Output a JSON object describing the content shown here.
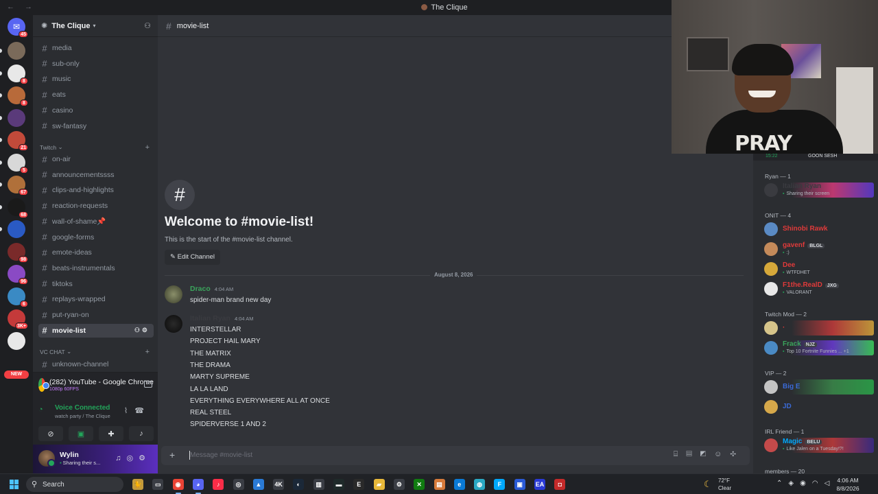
{
  "window": {
    "title": "The Clique",
    "nav": "← →"
  },
  "rail": {
    "home_badge": "45",
    "servers": [
      {
        "color": "#7a6a5a",
        "badge": ""
      },
      {
        "color": "#e8e8e8",
        "badge": "8"
      },
      {
        "color": "#b86a3a",
        "badge": "8"
      },
      {
        "color": "#5a3a7a",
        "badge": ""
      },
      {
        "color": "#c24a3a",
        "badge": "21"
      },
      {
        "color": "#d8d8d8",
        "badge": "5"
      },
      {
        "color": "#b0703a",
        "badge": "67"
      },
      {
        "color": "#1a1a1a",
        "badge": "68"
      },
      {
        "color": "#2a5ac4",
        "badge": ""
      },
      {
        "color": "#7a2a2a",
        "badge": "98"
      },
      {
        "color": "#8a4ac4",
        "badge": "96"
      },
      {
        "color": "#3a8ac4",
        "badge": "6"
      },
      {
        "color": "#c43a3a",
        "badge": "3K+"
      },
      {
        "color": "#e8e8e8",
        "badge": ""
      }
    ],
    "new_label": "NEW"
  },
  "server": {
    "name": "The Clique"
  },
  "channels_top": [
    "media",
    "sub-only",
    "music",
    "eats",
    "casino",
    "sw-fantasy"
  ],
  "categories": {
    "twitch": "Twitch",
    "vc": "VC CHAT"
  },
  "channels_twitch": [
    "on-air",
    "announcementssss",
    "clips-and-highlights",
    "reaction-requests",
    "wall-of-shame📌",
    "google-forms",
    "emote-ideas",
    "beats-instrumentals",
    "tiktoks",
    "replays-wrapped",
    "put-ryan-on",
    "movie-list"
  ],
  "channels_vc": [
    "unknown-channel"
  ],
  "stream": {
    "title": "(282) YouTube - Google Chrome",
    "quality": "1080p 60FPS"
  },
  "voice": {
    "title": "Voice Connected",
    "subtitle": "watch party / The Clique"
  },
  "user": {
    "name": "Wylin",
    "status": "Sharing their s..."
  },
  "chat": {
    "channel": "movie-list",
    "welcome_title": "Welcome to #movie-list!",
    "welcome_sub": "This is the start of the #movie-list channel.",
    "edit_label": "Edit Channel",
    "date": "August 8, 2026",
    "messages": [
      {
        "author": "Draco",
        "color": "#3ba55c",
        "time": "4:04 AM",
        "lines": [
          "spider-man brand new day"
        ]
      },
      {
        "author": "Italian Ryan",
        "color": "#3a3b40",
        "time": "4:04 AM",
        "lines": [
          "INTERSTELLAR",
          "PROJECT HAIL MARY",
          "THE MATRIX",
          "THE DRAMA",
          "MARTY SUPREME",
          "LA LA LAND",
          "EVERYTHING EVERYWHERE ALL AT ONCE",
          "REAL STEEL",
          "SPIDERVERSE 1 AND 2"
        ]
      }
    ],
    "placeholder": "Message #movie-list"
  },
  "cam_overlay": {
    "time": "15:22",
    "label": "GOON SESH",
    "shirt_text": "PRAY"
  },
  "members": {
    "groups": [
      {
        "title": "Ryan — 1",
        "members": [
          {
            "name": "Italian Ryan",
            "color": "#3a3b40",
            "status": "Sharing their screen",
            "tag": "",
            "bar": "linear-gradient(90deg, transparent, #d63a7a, #5a3ad6)"
          }
        ]
      },
      {
        "title": "ONIT — 4",
        "members": [
          {
            "name": "Shinobi Rawk",
            "color": "#e03a3a",
            "status": "",
            "tag": "",
            "bar": ""
          },
          {
            "name": "gavenf",
            "color": "#e03a3a",
            "status": ":)",
            "tag": "BLGL",
            "bar": ""
          },
          {
            "name": "Dee",
            "color": "#e03a3a",
            "status": "WTFDHET",
            "tag": "",
            "bar": ""
          },
          {
            "name": "F1the.RealD",
            "color": "#e03a3a",
            "status": "VALORANT",
            "tag": "JXG",
            "bar": ""
          }
        ]
      },
      {
        "title": "Twitch Mod — 2",
        "members": [
          {
            "name": "·",
            "color": "#e03a3a",
            "status": "",
            "tag": "",
            "bar": "linear-gradient(90deg, transparent, #c43a3a, #d6a83a)"
          },
          {
            "name": "Frack",
            "color": "#3ba55c",
            "status": "Top 10 Fortnite Funnies ... +1",
            "tag": "NJZ",
            "bar": "linear-gradient(90deg, transparent, #6a3ad6, #3ad65a)"
          }
        ]
      },
      {
        "title": "VIP — 2",
        "members": [
          {
            "name": "Big E",
            "color": "#3a6ad6",
            "status": "",
            "tag": "",
            "bar": "linear-gradient(90deg, transparent, #3a8a4a, #2aa84a)"
          },
          {
            "name": "JD",
            "color": "#3a6ad6",
            "status": "",
            "tag": "",
            "bar": ""
          }
        ]
      },
      {
        "title": "IRL Friend — 1",
        "members": [
          {
            "name": "Magic",
            "color": "#00a8fc",
            "status": "Like Jalen on a Tuesday!?!",
            "tag": "BELU",
            "bar": "linear-gradient(90deg, transparent, #c43a3a, #3a2a8a)"
          }
        ]
      }
    ],
    "footer": "members — 20"
  },
  "taskbar": {
    "search": "Search",
    "weather_temp": "72°F",
    "weather_cond": "Clear",
    "time": "4:06 AM",
    "date": "8/8/2026"
  }
}
